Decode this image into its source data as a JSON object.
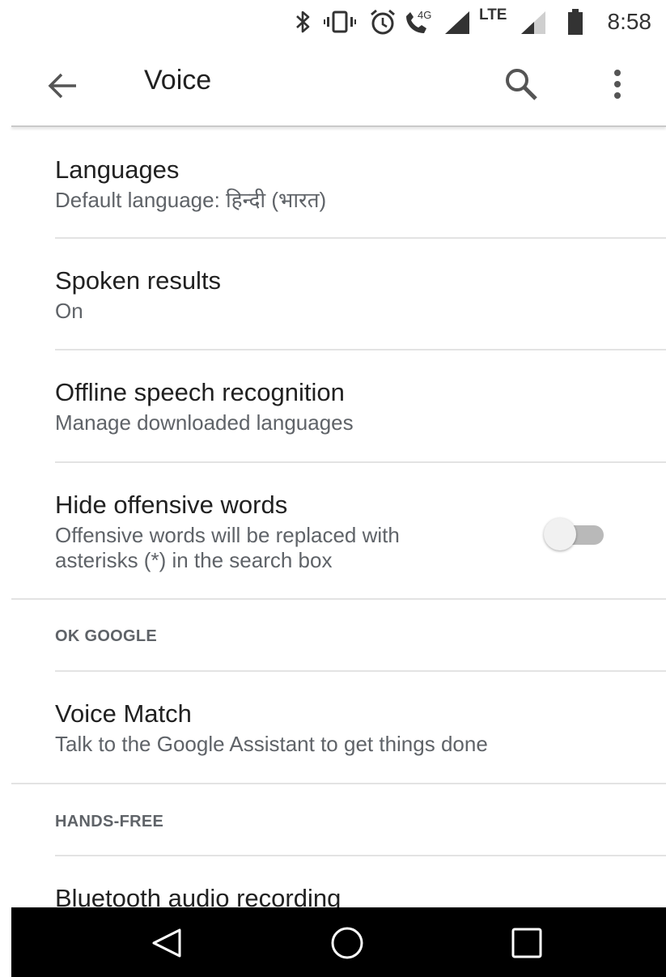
{
  "status_bar": {
    "time": "8:58",
    "network_label": "LTE",
    "data_label": "4G",
    "icons": [
      "bluetooth-icon",
      "vibrate-icon",
      "alarm-icon",
      "volte-call-icon",
      "signal-icon",
      "signal-icon",
      "battery-icon"
    ]
  },
  "app_bar": {
    "title": "Voice",
    "back_icon": "arrow-back-icon",
    "search_icon": "search-icon",
    "more_icon": "more-vert-icon"
  },
  "settings": [
    {
      "title": "Languages",
      "subtitle": "Default language: हिन्दी (भारत)"
    },
    {
      "title": "Spoken results",
      "subtitle": "On"
    },
    {
      "title": "Offline speech recognition",
      "subtitle": "Manage downloaded languages"
    },
    {
      "title": "Hide offensive words",
      "subtitle_line1": "Offensive words will be replaced with",
      "subtitle_line2": "asterisks (*) in the search box",
      "toggle_on": false
    }
  ],
  "sections": {
    "ok_google": {
      "header": "OK GOOGLE",
      "items": [
        {
          "title": "Voice Match",
          "subtitle": "Talk to the Google Assistant to get things done"
        }
      ]
    },
    "hands_free": {
      "header": "HANDS-FREE",
      "items": [
        {
          "title": "Bluetooth audio recording"
        }
      ]
    }
  },
  "nav_bar": {
    "icons": [
      "back-triangle-icon",
      "home-circle-icon",
      "recents-square-icon"
    ]
  },
  "colors": {
    "title_text": "#212121",
    "secondary_text": "#5f6368",
    "divider": "#e3e3e3",
    "toggle_track_off": "#b9b9b9",
    "toggle_thumb_off": "#f1f1f1",
    "nav_bar": "#000000"
  }
}
